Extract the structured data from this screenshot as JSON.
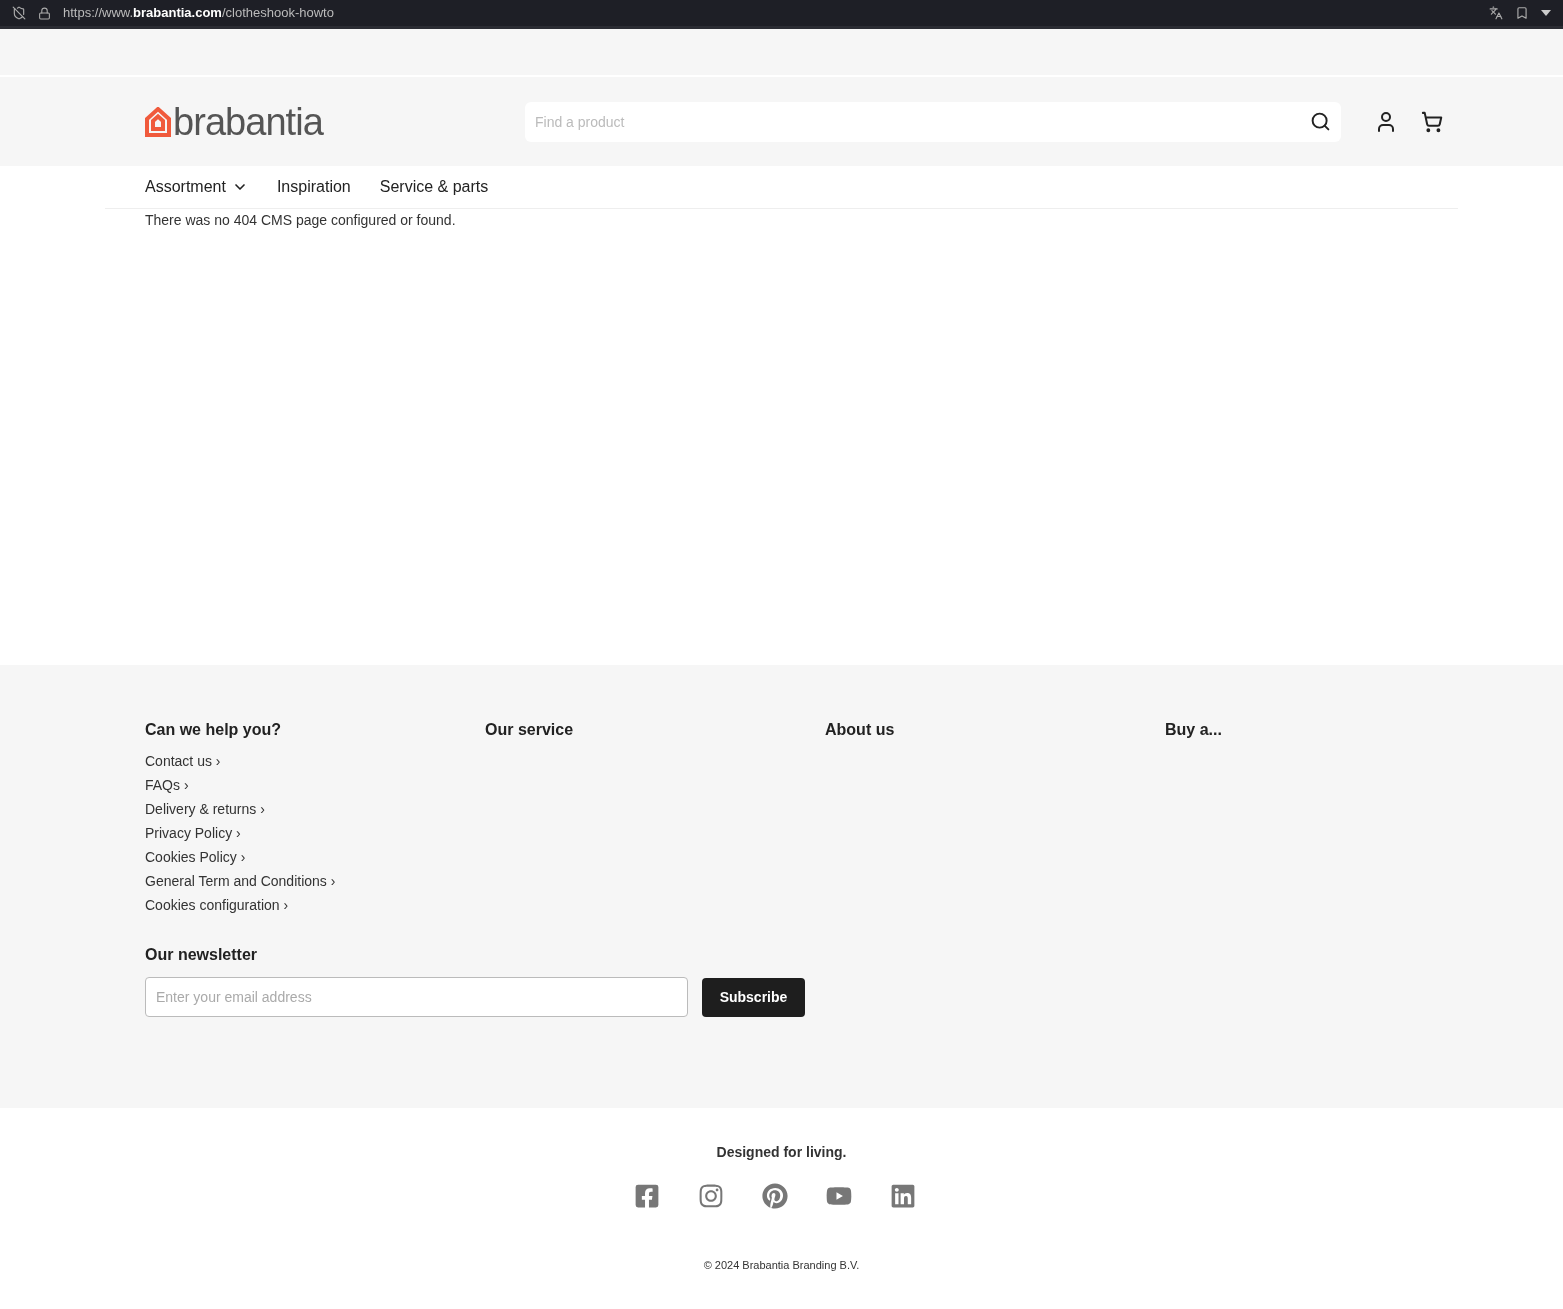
{
  "browser": {
    "url": "https://www.**brabantia.com**/clotheshook-howto"
  },
  "header": {
    "logo": "brabantia",
    "search": {
      "placeholder": "Find a product"
    }
  },
  "nav": [
    {
      "label": "Assortment",
      "dropdown": true
    },
    {
      "label": "Inspiration",
      "dropdown": false
    },
    {
      "label": "Service & parts",
      "dropdown": false
    }
  ],
  "message": "There was no 404 CMS page configured or found.",
  "footer": {
    "columns": [
      {
        "title": "Can we help you?",
        "links": [
          "Contact us",
          "FAQs",
          "Delivery & returns",
          "Privacy Policy",
          "Cookies Policy",
          "General Term and Conditions",
          "Cookies configuration"
        ]
      },
      {
        "title": "Our service"
      },
      {
        "title": "About us"
      },
      {
        "title": "Buy a..."
      }
    ],
    "link_arrow": "›",
    "newsletter": {
      "title": "Our newsletter",
      "placeholder": "Enter your email address",
      "button": "Subscribe"
    }
  },
  "bottom": {
    "tagline": "Designed for living.",
    "copyright": "© 2024 Brabantia Branding B.V."
  }
}
